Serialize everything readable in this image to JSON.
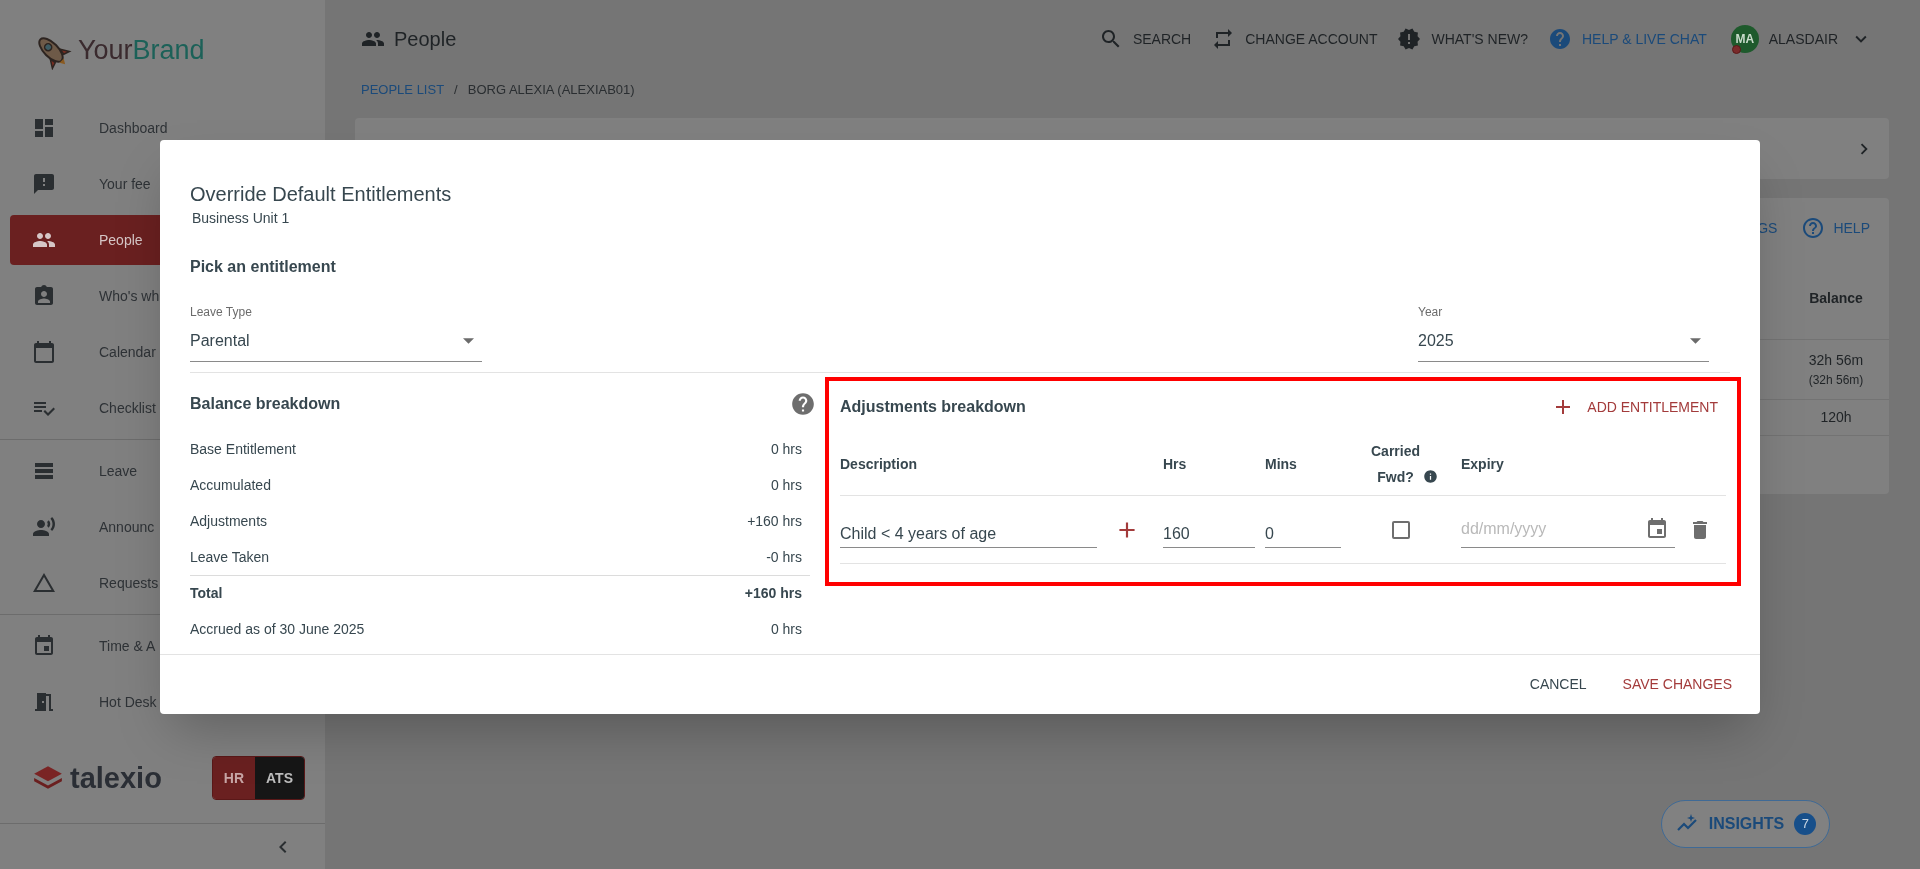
{
  "sidebar": {
    "brand": {
      "part_1": "Your",
      "part_2": "Brand"
    },
    "groups": [
      {
        "items": [
          {
            "label": "Dashboard",
            "selected": false
          },
          {
            "label": "Your fee",
            "selected": false
          },
          {
            "label": "People",
            "selected": true
          },
          {
            "label": "Who's wh",
            "selected": false
          },
          {
            "label": "Calendar",
            "selected": false
          },
          {
            "label": "Checklist",
            "selected": false
          }
        ]
      },
      {
        "items": [
          {
            "label": "Leave",
            "selected": false
          },
          {
            "label": "Announc",
            "selected": false
          },
          {
            "label": "Requests",
            "selected": false
          }
        ]
      },
      {
        "items": [
          {
            "label": "Time & A",
            "selected": false
          },
          {
            "label": "Hot Desk",
            "selected": false
          }
        ]
      }
    ],
    "footer": {
      "logo": "talexio",
      "modules": [
        {
          "label": "HR",
          "selected": true
        },
        {
          "label": "ATS",
          "selected": false
        }
      ]
    }
  },
  "topbar": {
    "title": "People",
    "actions": [
      {
        "label": "SEARCH",
        "highlight": false
      },
      {
        "label": "CHANGE ACCOUNT",
        "highlight": false
      },
      {
        "label": "WHAT'S NEW?",
        "highlight": false
      },
      {
        "label": "HELP & LIVE CHAT",
        "highlight": true
      }
    ],
    "user": {
      "initials": "MA",
      "name": "ALASDAIR"
    }
  },
  "breadcrumb": {
    "items": [
      {
        "label": "PEOPLE LIST",
        "link": true
      },
      {
        "label": "BORG ALEXIA (ALEXIAB01)",
        "link": false
      }
    ],
    "separator": "/"
  },
  "background_card": {
    "actions": [
      "GS",
      "HELP"
    ],
    "column": "Balance",
    "rows": [
      {
        "value": "32h 56m",
        "sub": "(32h 56m)"
      },
      {
        "value": "120h"
      }
    ]
  },
  "insights": {
    "label": "INSIGHTS",
    "count": "7"
  },
  "dialog": {
    "title": "Override Default Entitlements",
    "subtitle": "Business Unit 1",
    "section": "Pick an entitlement",
    "leave_type": {
      "label": "Leave Type",
      "value": "Parental"
    },
    "year": {
      "label": "Year",
      "value": "2025"
    },
    "balance": {
      "title": "Balance breakdown",
      "rows": [
        {
          "label": "Base Entitlement",
          "value": "0 hrs",
          "kind": "normal"
        },
        {
          "label": "Accumulated",
          "value": "0 hrs",
          "kind": "normal"
        },
        {
          "label": "Adjustments",
          "value": "+160 hrs",
          "kind": "normal"
        },
        {
          "label": "Leave Taken",
          "value": "-0 hrs",
          "kind": "normal"
        },
        {
          "label": "Total",
          "value": "+160 hrs",
          "kind": "total"
        },
        {
          "label": "Accrued as of 30 June 2025",
          "value": "0 hrs",
          "kind": "normal"
        }
      ]
    },
    "adjustments": {
      "title": "Adjustments breakdown",
      "add_label": "ADD ENTITLEMENT",
      "highlighted": true,
      "columns": [
        "Description",
        "Hrs",
        "Mins",
        "Carried Fwd?",
        "Expiry"
      ],
      "rows": [
        {
          "description": "Child < 4 years of age",
          "hrs": "160",
          "mins": "0",
          "carried_fwd": false,
          "expiry_placeholder": "dd/mm/yyyy"
        }
      ]
    },
    "buttons": [
      {
        "label": "CANCEL",
        "kind": "secondary"
      },
      {
        "label": "SAVE CHANGES",
        "kind": "primary"
      }
    ]
  }
}
